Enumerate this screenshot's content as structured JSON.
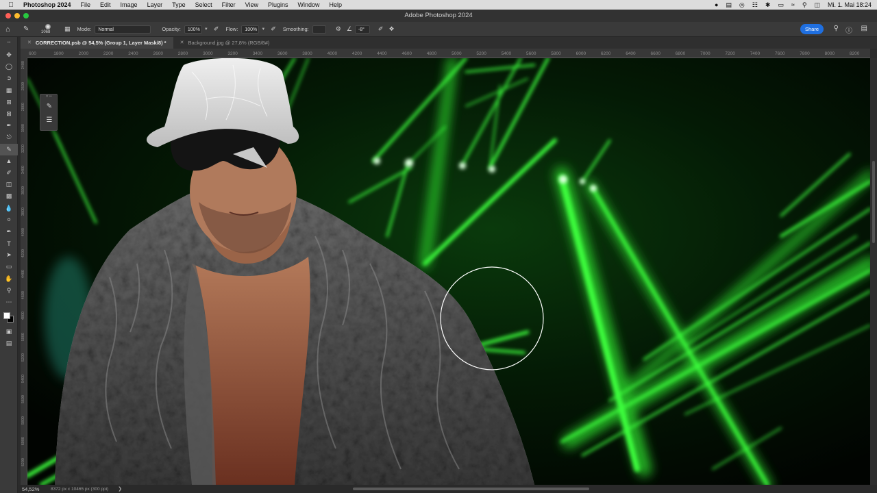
{
  "menubar": {
    "apple_icon": "apple-icon",
    "app_name": "Photoshop 2024",
    "items": [
      "File",
      "Edit",
      "Image",
      "Layer",
      "Type",
      "Select",
      "Filter",
      "View",
      "Plugins",
      "Window",
      "Help"
    ],
    "datetime": "Mi. 1. Mai  18:24"
  },
  "window": {
    "title": "Adobe Photoshop 2024"
  },
  "options": {
    "brush_size": "1068",
    "mode_label": "Mode:",
    "mode_value": "Normal",
    "opacity_label": "Opacity:",
    "opacity_value": "100%",
    "flow_label": "Flow:",
    "flow_value": "100%",
    "smoothing_label": "Smoothing:",
    "smoothing_value": "",
    "angle_value": "-8°",
    "share_label": "Share"
  },
  "tabs": [
    {
      "label": "CORRECTION.psb @ 54,5% (Group 1, Layer Mask/8) *",
      "active": true
    },
    {
      "label": "Background.jpg @ 27,8% (RGB/8#)",
      "active": false
    }
  ],
  "ruler": {
    "h_ticks": [
      "600",
      "1800",
      "2000",
      "2200",
      "2400",
      "2600",
      "2800",
      "3000",
      "3200",
      "3400",
      "3600",
      "3800",
      "4000",
      "4200",
      "4400",
      "4600",
      "4800",
      "5000",
      "5200",
      "5400",
      "5600",
      "5800",
      "6000",
      "6200",
      "6400",
      "6600",
      "6800",
      "7000",
      "7200",
      "7400",
      "7600",
      "7800",
      "8000",
      "8200"
    ],
    "v_ticks": [
      "2400",
      "2600",
      "2800",
      "3000",
      "3200",
      "3400",
      "3600",
      "3800",
      "4000",
      "4200",
      "4400",
      "4600",
      "4800",
      "5000",
      "5200",
      "5400",
      "5600",
      "5800",
      "6000",
      "6200"
    ]
  },
  "status": {
    "zoom": "54,52%",
    "dims": "8372 px x 10465 px (300 ppi)"
  },
  "colors": {
    "laser": "#39ff3a",
    "accent": "#1f6fe0"
  }
}
